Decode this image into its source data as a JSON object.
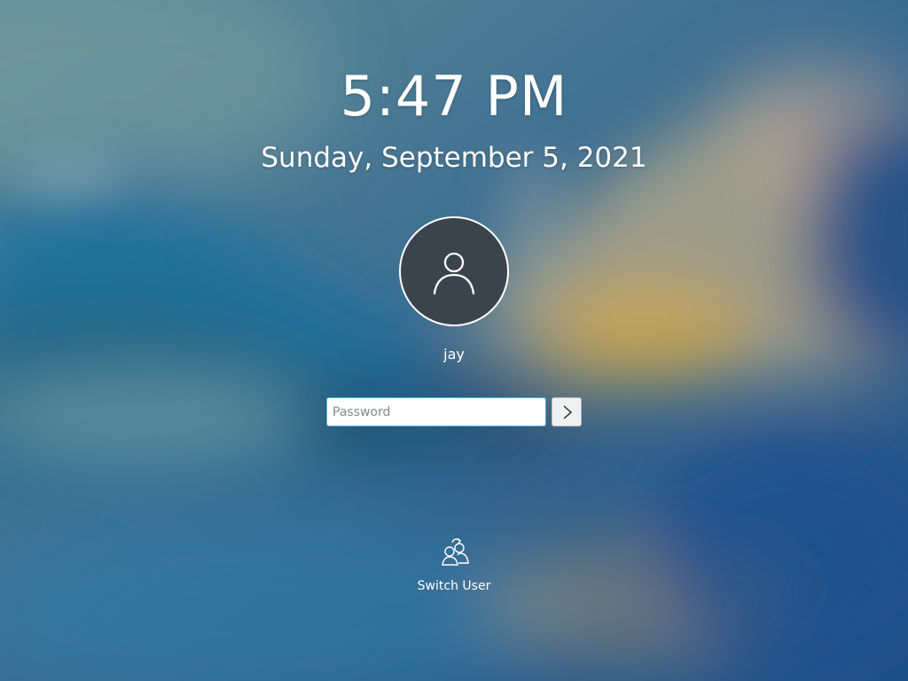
{
  "lockscreen": {
    "time": "5:47 PM",
    "date": "Sunday, September 5, 2021",
    "avatar_icon": "user-icon",
    "username": "jay",
    "password": {
      "value": "",
      "placeholder": "Password"
    },
    "login_button_icon": "chevron-right-icon",
    "switch_user": {
      "icon": "switch-user-icon",
      "label": "Switch User"
    }
  },
  "colors": {
    "accent": "#3daee9",
    "avatar_background": "#3b434c",
    "text": "#ffffff",
    "button_background": "#eff0f1"
  }
}
